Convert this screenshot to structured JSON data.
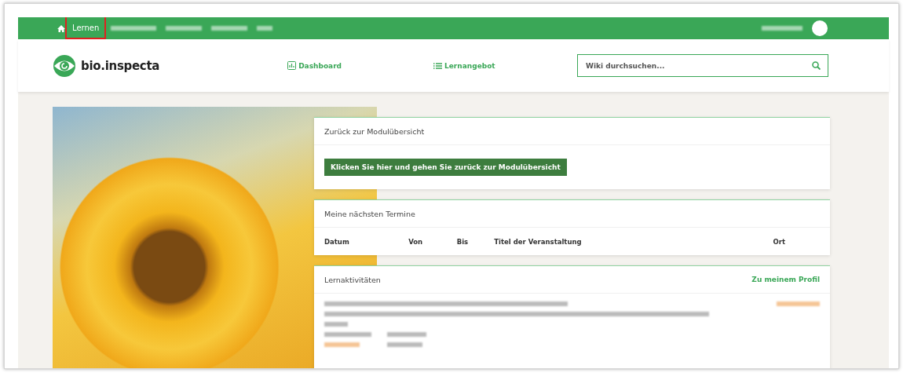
{
  "top_nav": {
    "items": [
      {
        "label": "Lernen",
        "selected": true
      }
    ]
  },
  "header": {
    "logo_text": "bio.inspecta",
    "links": [
      {
        "label": "Dashboard",
        "kind": "chart"
      },
      {
        "label": "Lernangebot",
        "kind": "list"
      }
    ],
    "search": {
      "placeholder": "Wiki durchsuchen..."
    }
  },
  "module_card": {
    "title": "Zurück zur Modulübersicht",
    "button": "Klicken Sie hier und gehen Sie zurück zur Modulübersicht"
  },
  "appointments_card": {
    "title": "Meine nächsten Termine",
    "columns": [
      "Datum",
      "Von",
      "Bis",
      "Titel der Veranstaltung",
      "Ort"
    ]
  },
  "activities_card": {
    "title": "Lernaktivitäten",
    "link": "Zu meinem Profil"
  }
}
